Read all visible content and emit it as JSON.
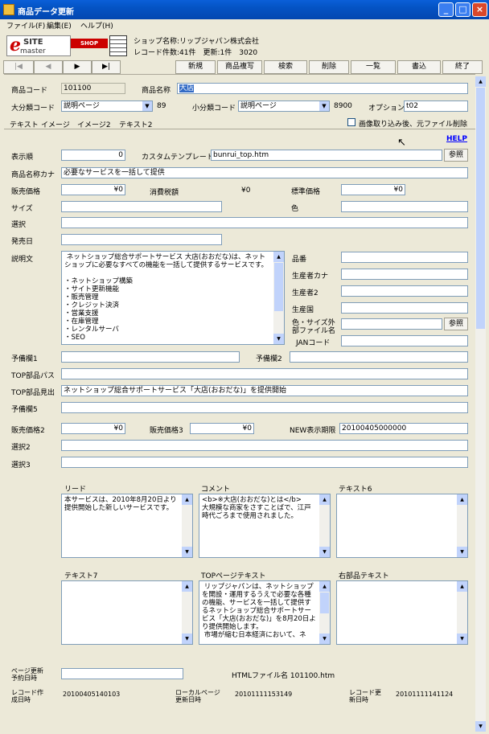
{
  "window": {
    "title": "商品データ更新"
  },
  "menu": [
    "ファイル(F)",
    "編集(E)",
    "ヘルプ(H)"
  ],
  "logo": {
    "main": "e SITE master",
    "badge": "SHOP"
  },
  "info": {
    "shop": "ショップ名称:リップジャパン株式会社",
    "records": "レコード件数:41件　更新:1件　3020"
  },
  "nav": [
    "|◀",
    "◀",
    "▶",
    "▶|"
  ],
  "toolbar": [
    "新規",
    "商品複写",
    "検索",
    "削除",
    "一覧",
    "書込",
    "終了"
  ],
  "fields": {
    "product_code_label": "商品コード",
    "product_code": "101100",
    "product_name_label": "商品名称",
    "product_name": "大店",
    "cat_large_label": "大分類コード",
    "cat_large": "説明ページ",
    "cat_large_num": "89",
    "cat_small_label": "小分類コード",
    "cat_small": "説明ページ",
    "cat_small_num": "8900",
    "option_label": "オプション",
    "option": "t02",
    "checkbox_label": "画像取り込み後、元ファイル削除",
    "help": "HELP",
    "order_label": "表示順",
    "order": "0",
    "template_label": "カスタムテンプレート",
    "template": "bunrui_top.htm",
    "ref": "参照",
    "kana_label": "商品名称カナ",
    "kana": "必要なサービスを一括して提供",
    "price_label": "販売価格",
    "price": "¥0",
    "tax_label": "消費税額",
    "tax": "¥0",
    "std_label": "標準価格",
    "std": "¥0",
    "size_label": "サイズ",
    "color_label": "色",
    "select_label": "選択",
    "release_label": "発売日",
    "desc_label": "説明文",
    "desc": " ネットショップ総合サポートサービス 大店(おおだな)は、ネットショップに必要なすべての機能を一括して提供するサービスです。\n\n・ネットショップ構築\n・サイト更新機能\n・販売管理\n・クレジット決済\n・営業支援\n・在庫管理\n・レンタルサーバ\n・SEO",
    "hinban_label": "品番",
    "maker_kana_label": "生産者カナ",
    "maker2_label": "生産者2",
    "country_label": "生産国",
    "colorsize_label1": "色・サイズ外",
    "colorsize_label2": "部ファイル名",
    "ref2": "参照",
    "jan_label": "JANコード",
    "spare1_label": "予備欄1",
    "spare2_label": "予備欄2",
    "top_path_label": "TOP部品パス",
    "top_head_label": "TOP部品見出",
    "top_head": "ネットショップ総合サポートサービス「大店(おおだな)」を提供開始",
    "spare5_label": "予備欄5",
    "price2_label": "販売価格2",
    "price2": "¥0",
    "price3_label": "販売価格3",
    "price3": "¥0",
    "new_label": "NEW表示期限",
    "new_val": "20100405000000",
    "select2_label": "選択2",
    "select3_label": "選択3",
    "lead_label": "リード",
    "lead": "本サービスは、2010年8月20日より提供開始した新しいサービスです。",
    "comment_label": "コメント",
    "comment": "<b>※大店(おおだな)とは</b>\n大規模な商家をさすことばで、江戸時代ごろまで使用されました。",
    "text6_label": "テキスト6",
    "text7_label": "テキスト7",
    "toptext_label": "TOPページテキスト",
    "toptext": " リップジャパンは、ネットショップを開設・運用するうえで必要な各種の機能、サービスを一括して提供するネットショップ総合サポートサービス「大店(おおだな)」を8月20日より提供開始します。\n 市場が縮む日本経済において、ネ",
    "right_text_label": "右部品テキスト",
    "page_update_label1": "ページ更新",
    "page_update_label2": "予約日時",
    "html_file": "HTMLファイル名 101100.htm",
    "created_label1": "レコード作",
    "created_label2": "成日時",
    "created": "20100405140103",
    "local_label1": "ローカルページ",
    "local_label2": "更新日時",
    "local": "20101111153149",
    "rec_upd_label1": "レコード更",
    "rec_upd_label2": "新日時",
    "rec_upd": "20101111141124"
  },
  "tabs": [
    "テキスト",
    "イメージ",
    "イメージ2",
    "テキスト2"
  ]
}
